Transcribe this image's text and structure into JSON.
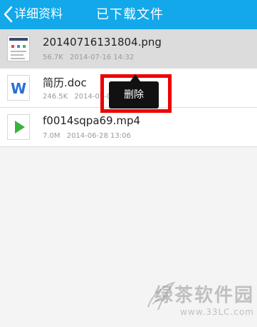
{
  "header": {
    "back_label": "详细资料",
    "title": "已下载文件",
    "bg_color": "#12a8ea"
  },
  "files": [
    {
      "name": "20140716131804.png",
      "size": "56.7K",
      "date": "2014-07-16 14:32",
      "icon": "image-thumbnail-icon",
      "selected": true
    },
    {
      "name": "简历.doc",
      "size": "246.5K",
      "date": "2014-07-0",
      "icon": "word-document-icon",
      "selected": false
    },
    {
      "name": "f0014sqpa69.mp4",
      "size": "7.0M",
      "date": "2014-06-28 13:06",
      "icon": "video-play-icon",
      "selected": false
    }
  ],
  "popup": {
    "delete_label": "删除",
    "highlight_color": "#ee0000"
  },
  "watermark": {
    "brand": "绿茶软件园",
    "url": "www.33LC.com"
  }
}
